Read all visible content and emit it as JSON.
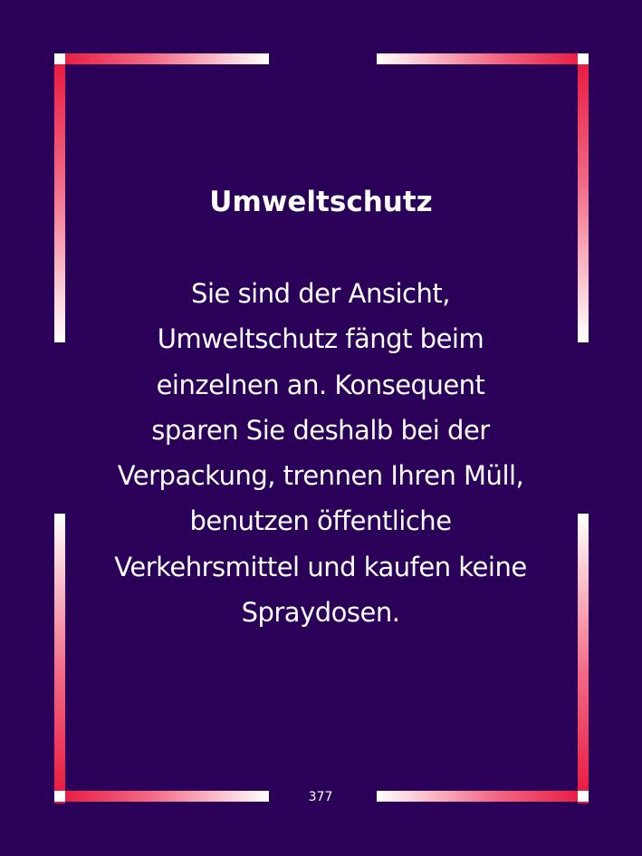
{
  "card": {
    "title": "Umweltschutz",
    "body": "Sie sind der Ansicht, Umweltschutz fängt beim einzelnen an. Konsequent sparen Sie deshalb bei der Verpackung, trennen Ihren Müll, benutzen öffentliche Verkehrsmittel und kaufen keine Spraydosen.",
    "page_number": "377"
  },
  "colors": {
    "background": "#2a0058",
    "frame_accent": "#e8153c",
    "frame_light": "#ffffff",
    "text": "#ffffff"
  }
}
